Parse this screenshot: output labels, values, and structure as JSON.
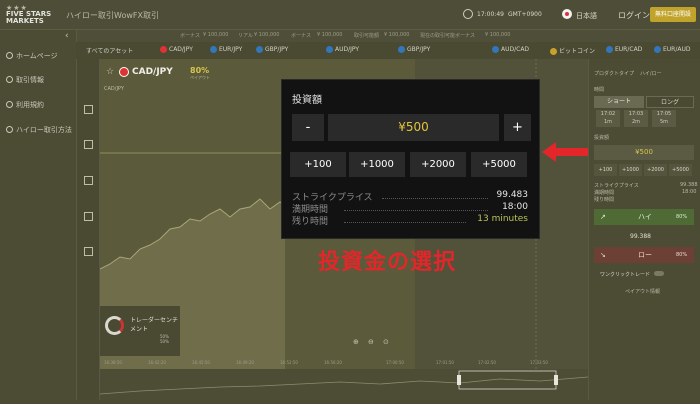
{
  "header": {
    "logo_stars": "★★★",
    "logo_line1": "FIVE STARS",
    "logo_line2": "MARKETS",
    "tabs": [
      "ハイロー取引",
      "WowFX取引"
    ],
    "time": "17:00:49",
    "timezone": "GMT+0900",
    "language": "日本語",
    "login_label": "ログイン",
    "signup_label": "無料口座開設"
  },
  "subbar": {
    "items": [
      "ボーナス",
      "¥ 100,000",
      "リアル",
      "¥ 100,000",
      "ボーナス",
      "¥ 100,000",
      "取引可能額",
      "¥ 100,000",
      "現在の取引可能ボーナス",
      "¥ 100,000"
    ]
  },
  "sidebar": {
    "items": [
      {
        "label": "ホームページ",
        "icon": "home-icon"
      },
      {
        "label": "取引情報",
        "icon": "info-icon"
      },
      {
        "label": "利用規約",
        "icon": "document-icon"
      },
      {
        "label": "ハイロー取引方法",
        "icon": "help-icon"
      }
    ]
  },
  "assetbar": {
    "all_label": "すべてのアセット",
    "assets": [
      "CAD/JPY",
      "EUR/JPY",
      "GBP/JPY",
      "AUD/JPY",
      "GBP/JPY",
      "AUD/CAD",
      "ビットコイン",
      "EUR/CAD",
      "EUR/AUD"
    ]
  },
  "chart": {
    "pair": "CAD/JPY",
    "payout": "80%",
    "payout_sub": "ペイアウト",
    "pair_small": "CAD/JPY",
    "x_ticks": [
      "16:38:50",
      "16:42:20",
      "16:45:50",
      "16:49:20",
      "16:52:50",
      "16:56:20",
      "17:00:50",
      "17:01:50",
      "17:02:50",
      "17:03:50"
    ]
  },
  "sentiment": {
    "title": "トレーダーセンチメント",
    "high": "50%",
    "low": "50%"
  },
  "right_panel": {
    "product_type_label": "プロダクトタイプ",
    "product_type_value": "ハイ/ロー",
    "time_label": "時間",
    "short_label": "ショート",
    "long_label": "ロング",
    "expiries": [
      {
        "time": "17:02",
        "sub": "1m"
      },
      {
        "time": "17:03",
        "sub": "2m"
      },
      {
        "time": "17:05",
        "sub": "5m"
      }
    ],
    "amount_label": "投資額",
    "amount_value": "¥500",
    "increments": [
      "+100",
      "+1000",
      "+2000",
      "+5000"
    ],
    "strike_label": "ストライクプライス",
    "strike_value": "99.388",
    "expiry_label": "満期時間",
    "expiry_value": "18:00",
    "remaining_label": "残り時間",
    "high_label": "ハイ",
    "high_pct": "80%",
    "price_display": "99.388",
    "low_label": "ロー",
    "low_pct": "80%",
    "one_click_label": "ワンクリックトレード",
    "payout_info_label": "ペイアウト情報"
  },
  "dialog": {
    "title": "投資額",
    "minus_label": "-",
    "amount": "¥500",
    "plus_label": "+",
    "increments": [
      "+100",
      "+1000",
      "+2000",
      "+5000"
    ],
    "strike_label": "ストライクプライス",
    "strike_value": "99.483",
    "expiry_label": "満期時間",
    "expiry_value": "18:00",
    "remaining_label": "残り時間",
    "remaining_value": "13 minutes"
  },
  "annotation": {
    "caption": "投資金の選択",
    "arrow_color": "#e2262a"
  },
  "colors": {
    "accent_gold": "#e2c33a",
    "high_green": "#4f6a35",
    "low_red": "#6c4034"
  }
}
